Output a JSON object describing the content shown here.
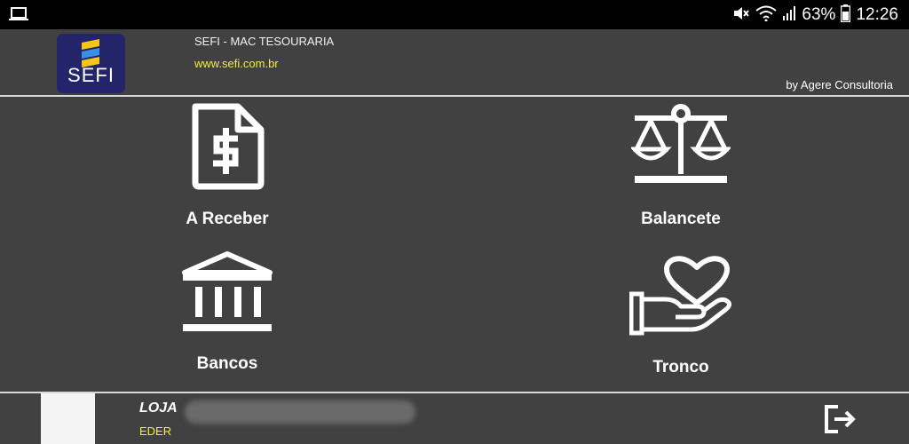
{
  "status_bar": {
    "battery": "63%",
    "time": "12:26",
    "icons": [
      "laptop-icon",
      "mute-icon",
      "wifi-icon",
      "signal-icon",
      "battery-icon"
    ]
  },
  "header": {
    "logo_text": "SEFI",
    "title": "SEFI - MAC TESOURARIA",
    "url": "www.sefi.com.br",
    "credit": "by Agere Consultoria"
  },
  "menu": {
    "items": [
      {
        "label": "A Receber",
        "icon": "invoice-dollar-icon"
      },
      {
        "label": "Balancete",
        "icon": "scale-icon"
      },
      {
        "label": "Bancos",
        "icon": "bank-icon"
      },
      {
        "label": "Tronco",
        "icon": "donation-hand-heart-icon"
      }
    ]
  },
  "footer": {
    "store_label": "LOJA",
    "user": "EDER",
    "logout_icon": "logout-icon"
  },
  "colors": {
    "background": "#414141",
    "status_bar": "#000000",
    "accent_yellow": "#f0ef3a",
    "logo_bg": "#23246a"
  }
}
